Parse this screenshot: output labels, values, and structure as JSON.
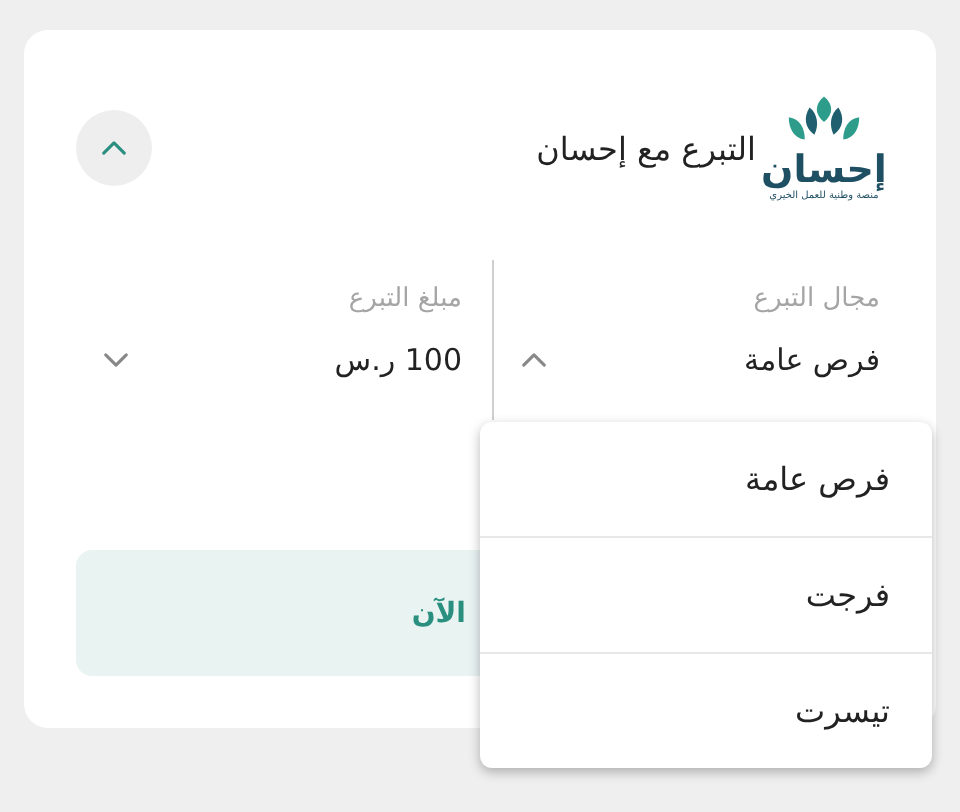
{
  "header": {
    "logo": {
      "name": "إحسان",
      "tagline": "منصة وطنية للعمل الخيري"
    },
    "title": "التبرع مع إحسان",
    "expanded": true
  },
  "fields": [
    {
      "label": "مجال التبرع",
      "value": "فرص عامة",
      "expanded": true
    },
    {
      "label": "مبلغ التبرع",
      "value": "100 ر.س",
      "expanded": false
    }
  ],
  "donate_button": {
    "label": "الآن"
  },
  "dropdown": {
    "options": [
      {
        "label": "فرص عامة"
      },
      {
        "label": "فرجت"
      },
      {
        "label": "تيسرت"
      }
    ]
  }
}
